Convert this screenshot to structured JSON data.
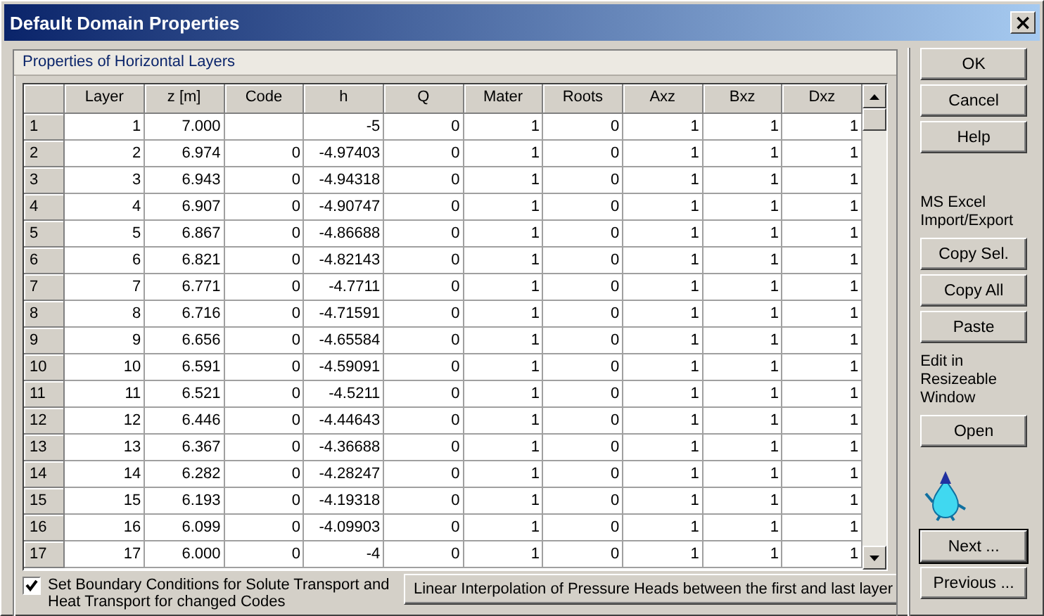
{
  "window": {
    "title": "Default Domain Properties",
    "close": "×"
  },
  "group": {
    "title": "Properties of Horizontal Layers"
  },
  "table": {
    "columns": [
      "Layer",
      "z [m]",
      "Code",
      "h",
      "Q",
      "Mater",
      "Roots",
      "Axz",
      "Bxz",
      "Dxz"
    ],
    "rows": [
      {
        "header": "1",
        "cells": [
          "1",
          "7.000",
          null,
          "-5",
          "0",
          "1",
          "0",
          "1",
          "1",
          "1"
        ]
      },
      {
        "header": "2",
        "cells": [
          "2",
          "6.974",
          "0",
          "-4.97403",
          "0",
          "1",
          "0",
          "1",
          "1",
          "1"
        ]
      },
      {
        "header": "3",
        "cells": [
          "3",
          "6.943",
          "0",
          "-4.94318",
          "0",
          "1",
          "0",
          "1",
          "1",
          "1"
        ]
      },
      {
        "header": "4",
        "cells": [
          "4",
          "6.907",
          "0",
          "-4.90747",
          "0",
          "1",
          "0",
          "1",
          "1",
          "1"
        ]
      },
      {
        "header": "5",
        "cells": [
          "5",
          "6.867",
          "0",
          "-4.86688",
          "0",
          "1",
          "0",
          "1",
          "1",
          "1"
        ]
      },
      {
        "header": "6",
        "cells": [
          "6",
          "6.821",
          "0",
          "-4.82143",
          "0",
          "1",
          "0",
          "1",
          "1",
          "1"
        ]
      },
      {
        "header": "7",
        "cells": [
          "7",
          "6.771",
          "0",
          "-4.7711",
          "0",
          "1",
          "0",
          "1",
          "1",
          "1"
        ]
      },
      {
        "header": "8",
        "cells": [
          "8",
          "6.716",
          "0",
          "-4.71591",
          "0",
          "1",
          "0",
          "1",
          "1",
          "1"
        ]
      },
      {
        "header": "9",
        "cells": [
          "9",
          "6.656",
          "0",
          "-4.65584",
          "0",
          "1",
          "0",
          "1",
          "1",
          "1"
        ]
      },
      {
        "header": "10",
        "cells": [
          "10",
          "6.591",
          "0",
          "-4.59091",
          "0",
          "1",
          "0",
          "1",
          "1",
          "1"
        ]
      },
      {
        "header": "11",
        "cells": [
          "11",
          "6.521",
          "0",
          "-4.5211",
          "0",
          "1",
          "0",
          "1",
          "1",
          "1"
        ]
      },
      {
        "header": "12",
        "cells": [
          "12",
          "6.446",
          "0",
          "-4.44643",
          "0",
          "1",
          "0",
          "1",
          "1",
          "1"
        ]
      },
      {
        "header": "13",
        "cells": [
          "13",
          "6.367",
          "0",
          "-4.36688",
          "0",
          "1",
          "0",
          "1",
          "1",
          "1"
        ]
      },
      {
        "header": "14",
        "cells": [
          "14",
          "6.282",
          "0",
          "-4.28247",
          "0",
          "1",
          "0",
          "1",
          "1",
          "1"
        ]
      },
      {
        "header": "15",
        "cells": [
          "15",
          "6.193",
          "0",
          "-4.19318",
          "0",
          "1",
          "0",
          "1",
          "1",
          "1"
        ]
      },
      {
        "header": "16",
        "cells": [
          "16",
          "6.099",
          "0",
          "-4.09903",
          "0",
          "1",
          "0",
          "1",
          "1",
          "1"
        ]
      },
      {
        "header": "17",
        "cells": [
          "17",
          "6.000",
          "0",
          "-4",
          "0",
          "1",
          "0",
          "1",
          "1",
          "1"
        ]
      }
    ]
  },
  "checkbox": {
    "label": "Set Boundary Conditions for Solute Transport and Heat Transport for changed Codes",
    "checked": true
  },
  "interpolate_button": "Linear Interpolation of Pressure Heads between the first and last layer",
  "side": [
    {
      "kind": "button",
      "label": "OK"
    },
    {
      "kind": "button",
      "label": "Cancel"
    },
    {
      "kind": "button",
      "label": "Help"
    },
    {
      "kind": "gap"
    },
    {
      "kind": "text",
      "label": "MS Excel Import/Export"
    },
    {
      "kind": "button",
      "label": "Copy Sel."
    },
    {
      "kind": "button",
      "label": "Copy All"
    },
    {
      "kind": "button",
      "label": "Paste"
    },
    {
      "kind": "text",
      "label": "Edit in Resizeable Window"
    },
    {
      "kind": "button",
      "label": "Open"
    },
    {
      "kind": "mascot"
    },
    {
      "kind": "default",
      "label": "Next ..."
    },
    {
      "kind": "button",
      "label": "Previous ..."
    }
  ]
}
